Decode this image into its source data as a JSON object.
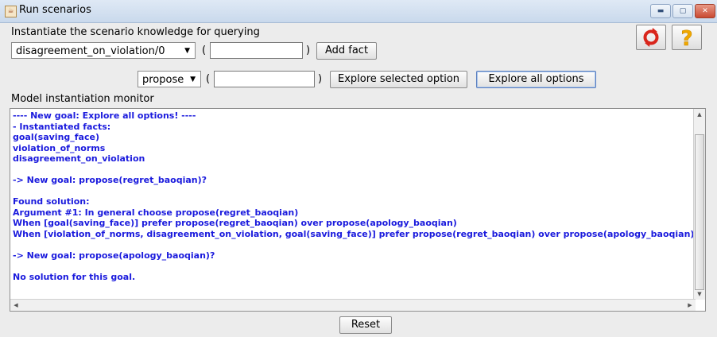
{
  "window": {
    "title": "Run scenarios",
    "app_icon": "java-cup-icon"
  },
  "header": {
    "instantiate_label": "Instantiate the scenario knowledge for querying"
  },
  "fact_row": {
    "select_value": "disagreement_on_violation/0",
    "open_paren": "(",
    "close_paren": ")",
    "input_value": "",
    "add_button": "Add fact"
  },
  "query_row": {
    "select_value": "propose",
    "open_paren": "(",
    "close_paren": ")",
    "input_value": "",
    "explore_selected": "Explore selected option",
    "explore_all": "Explore all options"
  },
  "monitor": {
    "label": "Model instantiation monitor",
    "lines": [
      "---- New goal: Explore all options! ----",
      "- Instantiated facts:",
      "goal(saving_face)",
      "violation_of_norms",
      "disagreement_on_violation",
      "",
      "-> New goal: propose(regret_baoqian)?",
      "",
      "Found solution:",
      "Argument #1: In general choose propose(regret_baoqian)",
      "When [goal(saving_face)] prefer propose(regret_baoqian) over propose(apology_baoqian)",
      "When [violation_of_norms, disagreement_on_violation, goal(saving_face)] prefer propose(regret_baoqian) over propose(apology_baoqian)",
      "",
      "-> New goal: propose(apology_baoqian)?",
      "",
      "No solution for this goal."
    ],
    "text_color": "#1a1add"
  },
  "footer": {
    "reset_button": "Reset"
  },
  "icons": {
    "reset_icon_color": "#d9261c",
    "help_icon_color": "#f0a800"
  }
}
